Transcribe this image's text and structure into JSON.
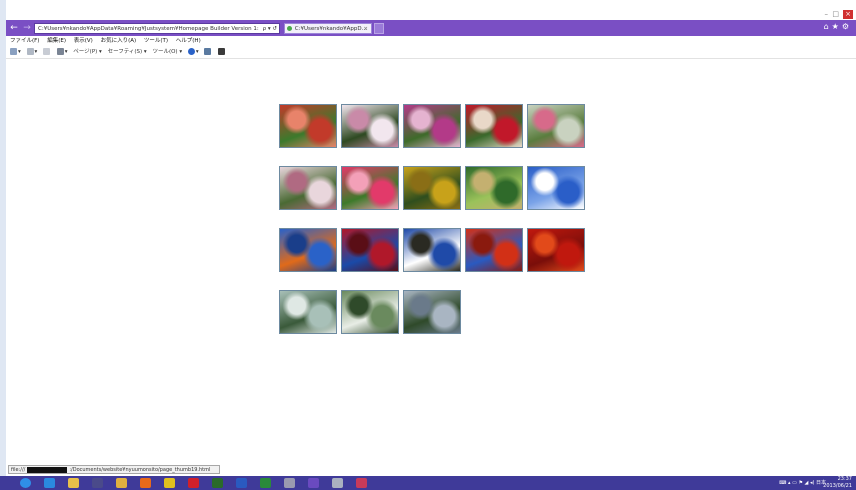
{
  "browser": {
    "address_url": "C:¥Users¥nkando¥AppData¥Roaming¥Justsystem¥Homepage Builder Version 1:",
    "address_icons": "ρ ▾ ↺",
    "tab_title": "C:¥Users¥nkando¥AppD...",
    "tab_close": "×",
    "back_icon": "←",
    "forward_icon": "→",
    "window_controls": [
      "–",
      "□",
      "×"
    ],
    "right_icons": "⌂★⚙"
  },
  "menu": [
    "ファイル(F)",
    "編集(E)",
    "表示(V)",
    "お気に入り(A)",
    "ツール(T)",
    "ヘルプ(H)"
  ],
  "commandbar": {
    "page": "ページ(P) ▾",
    "safety": "セーフティ(S) ▾",
    "tools": "ツール(O) ▾",
    "help": "▾"
  },
  "gallery": {
    "rows": [
      [
        {
          "name": "red-roses",
          "colors": [
            "#c23a2a",
            "#3c7a2c",
            "#e8836a"
          ]
        },
        {
          "name": "pink-white-roses",
          "colors": [
            "#f2e6ee",
            "#2e4a22",
            "#c98aa8"
          ]
        },
        {
          "name": "magenta-roses",
          "colors": [
            "#b33a88",
            "#3e6b2a",
            "#e5b3d0"
          ]
        },
        {
          "name": "red-rose-bush",
          "colors": [
            "#c1182a",
            "#3a6a2c",
            "#e9d8c8"
          ]
        },
        {
          "name": "rose-garden",
          "colors": [
            "#c9d2c0",
            "#5a7d3e",
            "#d76a8a"
          ]
        }
      ],
      [
        {
          "name": "pale-roses",
          "colors": [
            "#e9d6dc",
            "#4a6a34",
            "#b06a82"
          ]
        },
        {
          "name": "pink-roses-bed",
          "colors": [
            "#e23a6a",
            "#3d7a2a",
            "#f3a0b8"
          ]
        },
        {
          "name": "autumn-hillside",
          "colors": [
            "#c8a21a",
            "#2f4e1e",
            "#8a6e16"
          ]
        },
        {
          "name": "garden-stream",
          "colors": [
            "#2f6a2a",
            "#9ac25a",
            "#c4b070"
          ]
        },
        {
          "name": "blue-sky-tree",
          "colors": [
            "#2a5ec8",
            "#7aa3e8",
            "#ffffff"
          ]
        }
      ],
      [
        {
          "name": "orange-leaves-sky",
          "colors": [
            "#2a62c8",
            "#e06a1a",
            "#1a3e8a"
          ]
        },
        {
          "name": "red-maple",
          "colors": [
            "#b0182a",
            "#1a4aa8",
            "#5a0e16"
          ]
        },
        {
          "name": "tree-silhouette",
          "colors": [
            "#1f4aa8",
            "#ffffff",
            "#2a2a22"
          ]
        },
        {
          "name": "red-foliage",
          "colors": [
            "#d23016",
            "#2a5ac0",
            "#8a1a0e"
          ]
        },
        {
          "name": "crimson-maple",
          "colors": [
            "#c0180e",
            "#7a0e0a",
            "#e24a1a"
          ]
        }
      ],
      [
        {
          "name": "pond-pagoda",
          "colors": [
            "#a8c0b8",
            "#3a5a3a",
            "#dfe8e4"
          ]
        },
        {
          "name": "pond-bridge",
          "colors": [
            "#6a8a5e",
            "#e8ede6",
            "#2f4a2a"
          ]
        },
        {
          "name": "pond-island",
          "colors": [
            "#a9b5c2",
            "#2f4a2a",
            "#6a7a8a"
          ]
        }
      ]
    ]
  },
  "status": {
    "prefix": "file:///",
    "path": ":/Documents/website¥nyuumonsito/page_thumb19.html"
  },
  "taskbar": {
    "icons": [
      {
        "name": "ie-icon",
        "color": "#2a8ae0"
      },
      {
        "name": "folder-icon",
        "color": "#e8c04a"
      },
      {
        "name": "person-icon",
        "color": "#4a4a8a"
      },
      {
        "name": "explorer-icon",
        "color": "#e0b040"
      },
      {
        "name": "firefox-icon",
        "color": "#e86a1a"
      },
      {
        "name": "chrome-icon",
        "color": "#e0c020"
      },
      {
        "name": "opera-icon",
        "color": "#d0202a"
      },
      {
        "name": "dreamweaver-icon",
        "color": "#2a6a2a"
      },
      {
        "name": "word-icon",
        "color": "#2a5ac0"
      },
      {
        "name": "excel-icon",
        "color": "#2a8a3a"
      },
      {
        "name": "settings-icon",
        "color": "#9a9ab0"
      },
      {
        "name": "vscode-icon",
        "color": "#6a4ac0"
      },
      {
        "name": "network-icon",
        "color": "#aab0c0"
      },
      {
        "name": "rubyrails-icon",
        "color": "#c83a5a"
      }
    ],
    "tray": "⌨  ▴  ▭  ⚑  ◢  ◂)  日本",
    "time": "23:37",
    "date": "2013/06/21"
  }
}
